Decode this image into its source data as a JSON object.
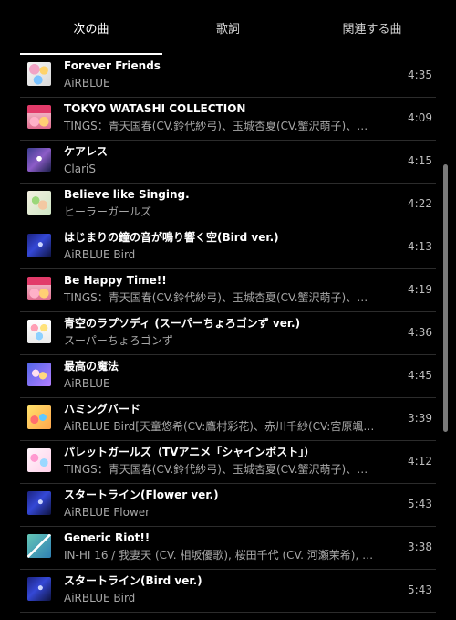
{
  "tabs": [
    {
      "label": "次の曲",
      "active": true
    },
    {
      "label": "歌詞",
      "active": false
    },
    {
      "label": "関連する曲",
      "active": false
    }
  ],
  "queue": [
    {
      "title": "Forever Friends",
      "artist": "AiRBLUE",
      "duration": "4:35",
      "thumb": "t-collage"
    },
    {
      "title": "TOKYO WATASHI COLLECTION",
      "artist": "TINGS：青天国春(CV.鈴代紗弓)、玉城杏夏(CV.蟹沢萌子)、…",
      "duration": "4:09",
      "thumb": "t-tokyo"
    },
    {
      "title": "ケアレス",
      "artist": "ClariS",
      "duration": "4:15",
      "thumb": "t-claris"
    },
    {
      "title": "Believe like Singing.",
      "artist": "ヒーラーガールズ",
      "duration": "4:22",
      "thumb": "t-healer"
    },
    {
      "title": "はじまりの鐘の音が鳴り響く空(Bird ver.)",
      "artist": "AiRBLUE Bird",
      "duration": "4:13",
      "thumb": "t-bird"
    },
    {
      "title": "Be Happy Time!!",
      "artist": "TINGS：青天国春(CV.鈴代紗弓)、玉城杏夏(CV.蟹沢萌子)、…",
      "duration": "4:19",
      "thumb": "t-tokyo"
    },
    {
      "title": "青空のラプソディ (スーパーちょろゴンず ver.)",
      "artist": "スーパーちょろゴンず",
      "duration": "4:36",
      "thumb": "t-super"
    },
    {
      "title": "最高の魔法",
      "artist": "AiRBLUE",
      "duration": "4:45",
      "thumb": "t-saikou"
    },
    {
      "title": "ハミングバード",
      "artist": "AiRBLUE Bird[天童悠希(CV:鷹村彩花)、赤川千紗(CV:宮原颯…",
      "duration": "3:39",
      "thumb": "t-humming"
    },
    {
      "title": "パレットガールズ（TVアニメ「シャインポスト」）",
      "artist": "TINGS：青天国春(CV.鈴代紗弓)、玉城杏夏(CV.蟹沢萌子)、…",
      "duration": "4:12",
      "thumb": "t-palette"
    },
    {
      "title": "スタートライン(Flower ver.)",
      "artist": "AiRBLUE Flower",
      "duration": "5:43",
      "thumb": "t-bird"
    },
    {
      "title": "Generic Riot!!",
      "artist": "IN-HI 16 / 我妻天 (CV. 相坂優歌), 桜田千代 (CV. 河瀬茉希), …",
      "duration": "3:38",
      "thumb": "t-riot"
    },
    {
      "title": "スタートライン(Bird ver.)",
      "artist": "AiRBLUE Bird",
      "duration": "5:43",
      "thumb": "t-bird"
    }
  ]
}
